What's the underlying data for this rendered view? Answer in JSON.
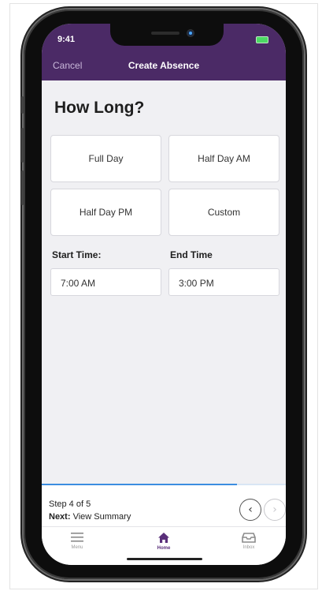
{
  "status_bar": {
    "time": "9:41"
  },
  "nav": {
    "cancel_label": "Cancel",
    "title": "Create Absence"
  },
  "main": {
    "heading": "How Long?",
    "options": [
      "Full Day",
      "Half Day AM",
      "Half Day PM",
      "Custom"
    ],
    "start_label": "Start Time:",
    "start_value": "7:00 AM",
    "end_label": "End Time",
    "end_value": "3:00 PM"
  },
  "progress": {
    "step_text": "Step 4 of 5",
    "next_prefix": "Next:",
    "next_value": "View Summary",
    "fraction": 0.8
  },
  "tabs": [
    {
      "label": "Menu",
      "icon": "hamburger-icon"
    },
    {
      "label": "Home",
      "icon": "home-icon",
      "active": true
    },
    {
      "label": "Inbox",
      "icon": "inbox-icon"
    }
  ],
  "colors": {
    "header": "#4b2a66",
    "accent": "#5a2f7a",
    "progress": "#3b8de0"
  }
}
